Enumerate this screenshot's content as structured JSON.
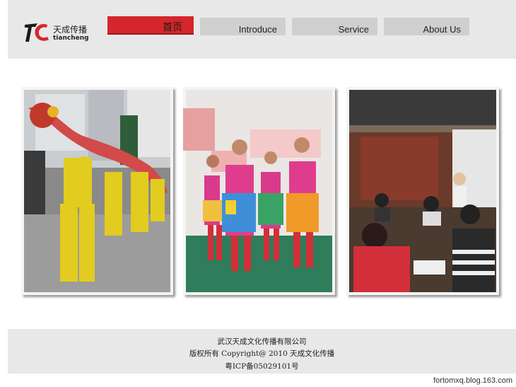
{
  "logo": {
    "name_cn": "天成传播",
    "name_en": "tiancheng"
  },
  "nav": [
    {
      "label": "首页",
      "active": true
    },
    {
      "label": "Introduce",
      "active": false
    },
    {
      "label": "Service",
      "active": false
    },
    {
      "label": "About Us",
      "active": false
    }
  ],
  "footer": {
    "company": "武汉天成文化传播有限公司",
    "copyright": "版权所有 Copyright@ 2010 天成文化传播",
    "icp": "粤ICP备05029101号"
  },
  "watermark": "fortomxq.blog.163.com",
  "colors": {
    "accent": "#d5262b",
    "header_bg": "#e8e8e8",
    "nav_grey": "#cfcfcf"
  }
}
